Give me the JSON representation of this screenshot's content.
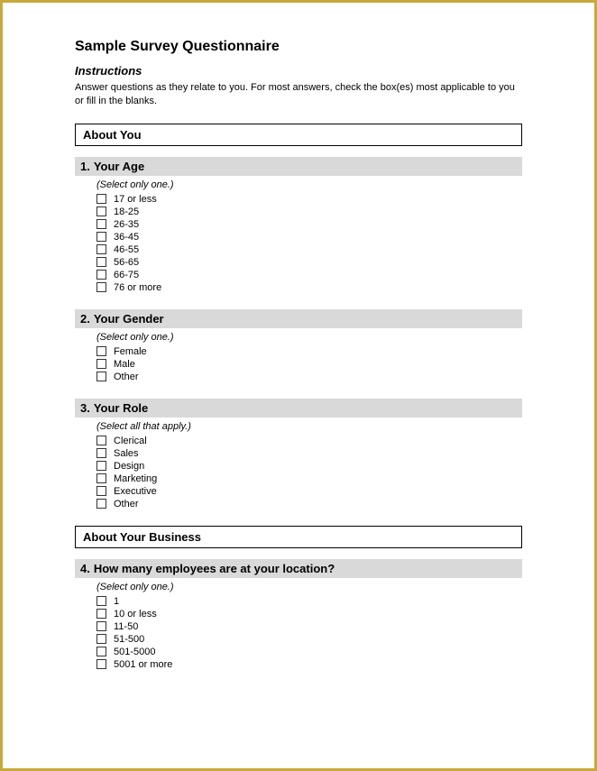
{
  "page": {
    "title": "Sample Survey Questionnaire",
    "instructions_heading": "Instructions",
    "instructions_text": "Answer questions as they relate to you. For most answers, check the box(es) most applicable to you or fill in the blanks."
  },
  "sections": [
    {
      "id": "about-you",
      "label": "About You",
      "questions": [
        {
          "number": "1.",
          "title": "Your Age",
          "subtitle": "(Select only one.)",
          "options": [
            "17 or less",
            "18-25",
            "26-35",
            "36-45",
            "46-55",
            "56-65",
            "66-75",
            "76 or more"
          ]
        },
        {
          "number": "2.",
          "title": "Your Gender",
          "subtitle": "(Select only one.)",
          "options": [
            "Female",
            "Male",
            "Other"
          ]
        },
        {
          "number": "3.",
          "title": "Your Role",
          "subtitle": "(Select all that apply.)",
          "options": [
            "Clerical",
            "Sales",
            "Design",
            "Marketing",
            "Executive",
            "Other"
          ]
        }
      ]
    },
    {
      "id": "about-your-business",
      "label": "About Your Business",
      "questions": [
        {
          "number": "4.",
          "title": "How many employees are at your location?",
          "subtitle": "(Select only one.)",
          "options": [
            "1",
            "10 or less",
            "11-50",
            "51-500",
            "501-5000",
            "5001 or more"
          ]
        }
      ]
    }
  ]
}
